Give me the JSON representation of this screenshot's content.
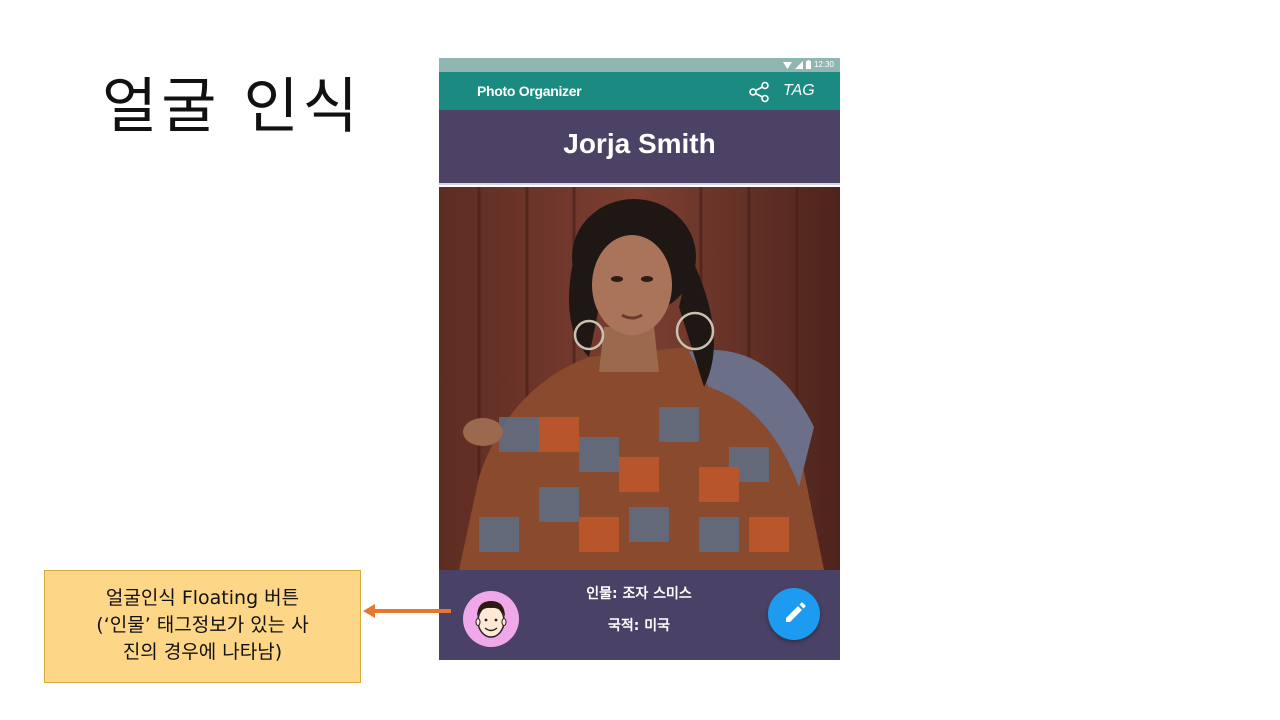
{
  "slide": {
    "title": "얼굴 인식"
  },
  "status_bar": {
    "time": "12:30",
    "icons": [
      "wifi-icon",
      "signal-icon",
      "battery-icon"
    ]
  },
  "app_bar": {
    "title": "Photo Organizer",
    "share_icon": "share-icon",
    "tag_label": "TAG",
    "color": "#1b8a80"
  },
  "photo_view": {
    "person_name": "Jorja Smith",
    "header_color": "#4b4265"
  },
  "info_panel": {
    "person_line": "인물: 조자 스미스",
    "nationality_line": "국적: 미국",
    "face_button_icon": "face-avatar-icon",
    "edit_button_icon": "pencil-icon",
    "face_button_color": "#f0a8ea",
    "edit_button_color": "#1d9bf0"
  },
  "callout": {
    "line1": "얼굴인식 Floating 버튼",
    "line2": "(‘인물’ 태그정보가 있는 사",
    "line3": "진의 경우에 나타남)",
    "arrow_color": "#e8772e",
    "background": "#fdd687"
  }
}
